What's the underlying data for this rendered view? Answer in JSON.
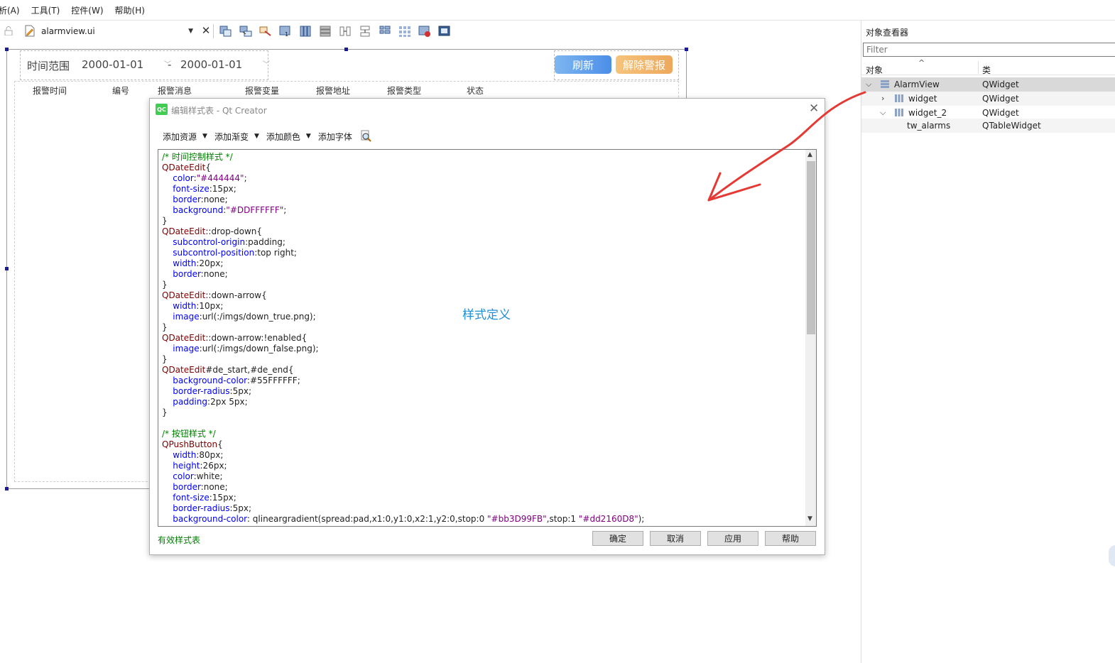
{
  "menubar": {
    "items": [
      "析(A)",
      "工具(T)",
      "控件(W)",
      "帮助(H)"
    ]
  },
  "toolbar": {
    "file_name": "alarmview.ui",
    "icons": [
      "lock-icon",
      "edit-file-icon",
      "close-icon",
      "edit-widgets-icon",
      "edit-signals-icon",
      "edit-buddies-icon",
      "edit-tab-order-icon",
      "layout-horizontal-icon",
      "layout-vertical-icon",
      "layout-h-splitter-icon",
      "layout-v-splitter-icon",
      "layout-form-icon",
      "layout-grid-icon",
      "break-layout-icon",
      "adjust-size-icon"
    ]
  },
  "form": {
    "time_range_label": "时间范围",
    "start_date": "2000-01-01",
    "end_date": "2000-01-01",
    "separator": "-",
    "refresh_button": "刷新",
    "clear_alarm_button": "解除警报",
    "refresh_color": "#4c8ee8",
    "clear_color": "#eda85c",
    "columns": [
      "报警时间",
      "编号",
      "报警消息",
      "报警变量",
      "报警地址",
      "报警类型",
      "状态"
    ]
  },
  "inspector": {
    "title": "对象查看器",
    "filter_placeholder": "Filter",
    "col_object": "对象",
    "col_class": "类",
    "rows": [
      {
        "name": "AlarmView",
        "cls": "QWidget"
      },
      {
        "name": "widget",
        "cls": "QWidget"
      },
      {
        "name": "widget_2",
        "cls": "QWidget"
      },
      {
        "name": "tw_alarms",
        "cls": "QTableWidget"
      }
    ]
  },
  "dialog": {
    "title": "编辑样式表 - Qt Creator",
    "tools": [
      "添加资源",
      "添加渐变",
      "添加颜色",
      "添加字体"
    ],
    "annotation": "样式定义",
    "status": "有效样式表",
    "buttons": {
      "ok": "确定",
      "cancel": "取消",
      "apply": "应用",
      "help": "帮助"
    },
    "code": [
      "/* 时间控制样式 */",
      "QDateEdit{",
      "    color:\"#444444\";",
      "    font-size:15px;",
      "    border:none;",
      "    background:\"#DDFFFFFF\";",
      "}",
      "QDateEdit::drop-down{",
      "    subcontrol-origin:padding;",
      "    subcontrol-position:top right;",
      "    width:20px;",
      "    border:none;",
      "}",
      "QDateEdit::down-arrow{",
      "    width:10px;",
      "    image:url(:/imgs/down_true.png);",
      "}",
      "QDateEdit::down-arrow:!enabled{",
      "    image:url(:/imgs/down_false.png);",
      "}",
      "QDateEdit#de_start,#de_end{",
      "    background-color:#55FFFFFF;",
      "    border-radius:5px;",
      "    padding:2px 5px;",
      "}",
      "",
      "/* 按钮样式 */",
      "QPushButton{",
      "    width:80px;",
      "    height:26px;",
      "    color:white;",
      "    border:none;",
      "    font-size:15px;",
      "    border-radius:5px;",
      "    background-color: qlineargradient(spread:pad,x1:0,y1:0,x2:1,y2:0,stop:0 \"#bb3D99FB\",stop:1 \"#dd2160D8\");"
    ]
  },
  "colors": {
    "comment": "#008000",
    "selector": "#800000",
    "property": "#0000ff",
    "string": "#800080",
    "annotation_arrow": "#e53935"
  }
}
